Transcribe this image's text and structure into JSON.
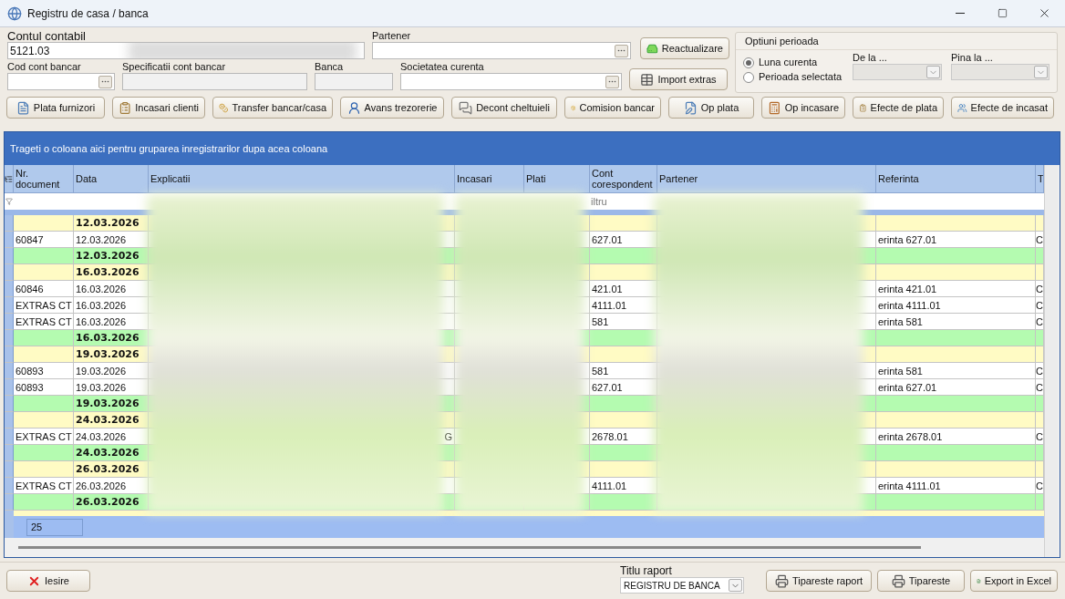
{
  "window": {
    "title": "Registru de casa / banca"
  },
  "form": {
    "account": {
      "label": "Contul contabil",
      "value": "5121.03"
    },
    "partner": {
      "label": "Partener"
    },
    "bank_code": {
      "label": "Cod cont bancar"
    },
    "bank_spec": {
      "label": "Specificatii cont bancar"
    },
    "bank": {
      "label": "Banca"
    },
    "company": {
      "label": "Societatea curenta"
    },
    "refresh_button": "Reactualizare",
    "import_button": "Import extras"
  },
  "period": {
    "title": "Optiuni perioada",
    "options": [
      {
        "label": "Luna curenta",
        "selected": true
      },
      {
        "label": "Perioada selectata",
        "selected": false
      }
    ],
    "from": {
      "label": "De la ...",
      "disabled": true
    },
    "to": {
      "label": "Pina la ...",
      "disabled": true
    }
  },
  "toolbar": [
    "Plata furnizori",
    "Incasari clienti",
    "Transfer bancar/casa",
    "Avans trezorerie",
    "Decont cheltuieli",
    "Comision bancar",
    "Op plata",
    "Op incasare",
    "Efecte de plata",
    "Efecte de incasat"
  ],
  "grid": {
    "group_hint": "Trageti o coloana aici pentru gruparea inregistrarilor dupa acea coloana",
    "columns": [
      "Nr. document",
      "Data",
      "Explicatii",
      "Incasari",
      "Plati",
      "Cont corespondent",
      "Partener",
      "Referinta",
      "T"
    ],
    "filter_hint": "iltru",
    "rows": [
      {
        "kind": "group",
        "data": "12.03.2026"
      },
      {
        "kind": "detail",
        "nr": "60847",
        "data": "12.03.2026",
        "cont": "627.01",
        "referinta": "erinta 627.01",
        "column_9": "C"
      },
      {
        "kind": "total",
        "data": "12.03.2026"
      },
      {
        "kind": "group",
        "data": "16.03.2026"
      },
      {
        "kind": "detail",
        "nr": "60846",
        "data": "16.03.2026",
        "cont": "421.01",
        "referinta": "erinta 421.01",
        "column_9": "C"
      },
      {
        "kind": "detail",
        "nr": "EXTRAS CT",
        "data": "16.03.2026",
        "cont": "4111.01",
        "referinta": "erinta 4111.01",
        "column_9": "C"
      },
      {
        "kind": "detail",
        "nr": "EXTRAS CT",
        "data": "16.03.2026",
        "cont": "581",
        "referinta": "erinta 581",
        "column_9": "C"
      },
      {
        "kind": "total",
        "data": "16.03.2026"
      },
      {
        "kind": "group",
        "data": "19.03.2026"
      },
      {
        "kind": "detail",
        "nr": "60893",
        "data": "19.03.2026",
        "cont": "581",
        "referinta": "erinta 581",
        "column_9": "C"
      },
      {
        "kind": "detail",
        "nr": "60893",
        "data": "19.03.2026",
        "cont": "627.01",
        "referinta": "erinta 627.01",
        "column_9": "C"
      },
      {
        "kind": "total",
        "data": "19.03.2026"
      },
      {
        "kind": "group",
        "data": "24.03.2026"
      },
      {
        "kind": "detail",
        "nr": "EXTRAS CT",
        "data": "24.03.2026",
        "explicatii": "G",
        "cont": "2678.01",
        "referinta": "erinta 2678.01",
        "column_9": "C"
      },
      {
        "kind": "total",
        "data": "24.03.2026"
      },
      {
        "kind": "group",
        "data": "26.03.2026"
      },
      {
        "kind": "detail",
        "nr": "EXTRAS CT",
        "data": "26.03.2026",
        "cont": "4111.01",
        "referinta": "erinta 4111.01",
        "column_9": "C"
      },
      {
        "kind": "total",
        "data": "26.03.2026"
      }
    ],
    "count": "25"
  },
  "footer": {
    "exit_button": "Iesire",
    "report_title": {
      "label": "Titlu raport",
      "value": "REGISTRU DE BANCA"
    },
    "buttons": [
      "Tipareste raport",
      "Tipareste",
      "Export in Excel"
    ]
  }
}
